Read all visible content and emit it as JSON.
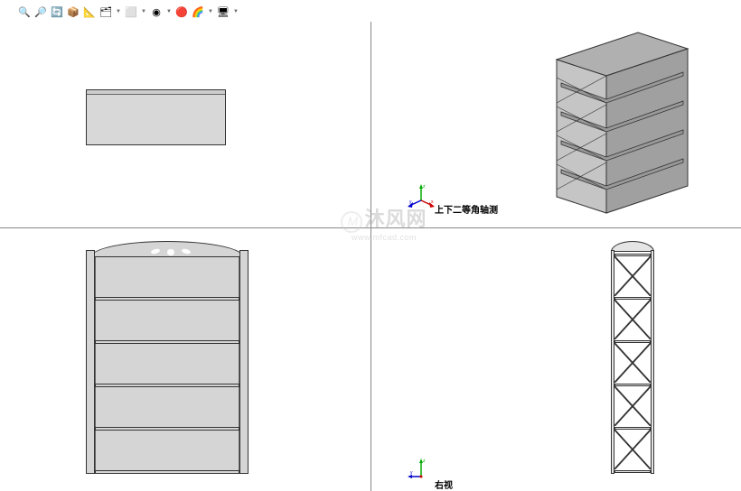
{
  "toolbar": {
    "icons": [
      {
        "name": "zoom-window-icon",
        "glyph": "🔍",
        "color": "#4a7db5"
      },
      {
        "name": "zoom-fit-icon",
        "glyph": "🔎",
        "color": "#4a7db5"
      },
      {
        "name": "rotate-icon",
        "glyph": "🔄",
        "color": "#d4a04a"
      },
      {
        "name": "pan-icon",
        "glyph": "📦",
        "color": "#4a9d5a"
      },
      {
        "name": "section-icon",
        "glyph": "📐",
        "color": "#6a8dbd"
      },
      {
        "name": "view-orientation-icon",
        "glyph": "🗂",
        "color": "#5a7da5"
      },
      {
        "name": "display-style-icon",
        "glyph": "⬜",
        "color": "#888"
      },
      {
        "name": "hide-show-icon",
        "glyph": "◉",
        "color": "#666"
      },
      {
        "name": "appearance-icon",
        "glyph": "🔴",
        "color": "#c94545"
      },
      {
        "name": "scene-icon",
        "glyph": "🌈",
        "color": "#4a7d9d"
      },
      {
        "name": "view-settings-icon",
        "glyph": "🖥",
        "color": "#666"
      }
    ]
  },
  "viewports": {
    "top_left": {
      "label": ""
    },
    "top_right": {
      "label": "上下二等角轴测",
      "triad": true
    },
    "bottom_left": {
      "label": ""
    },
    "bottom_right": {
      "label": "右视",
      "triad": true
    }
  },
  "watermark": {
    "main": "沐风网",
    "sub": "www.mfcad.com"
  },
  "triad_axes": {
    "x": "x",
    "y": "y",
    "z": "z"
  }
}
